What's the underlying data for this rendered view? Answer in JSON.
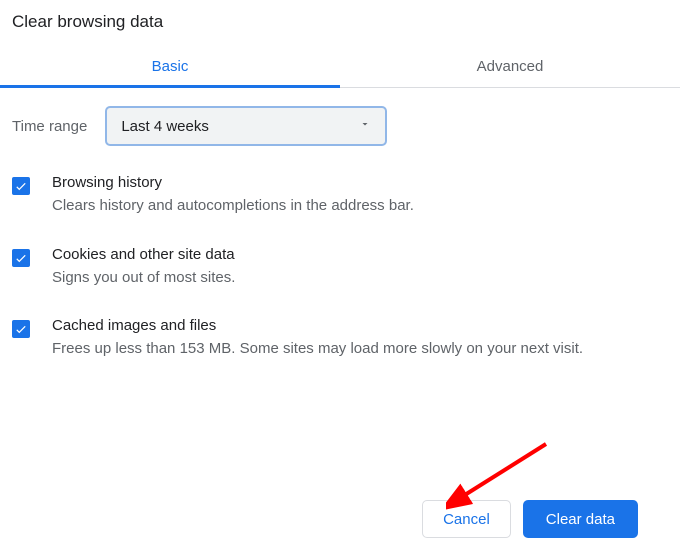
{
  "dialog": {
    "title": "Clear browsing data"
  },
  "tabs": {
    "basic": "Basic",
    "advanced": "Advanced"
  },
  "time": {
    "label": "Time range",
    "selected": "Last 4 weeks"
  },
  "options": [
    {
      "title": "Browsing history",
      "desc": "Clears history and autocompletions in the address bar."
    },
    {
      "title": "Cookies and other site data",
      "desc": "Signs you out of most sites."
    },
    {
      "title": "Cached images and files",
      "desc": "Frees up less than 153 MB. Some sites may load more slowly on your next visit."
    }
  ],
  "buttons": {
    "cancel": "Cancel",
    "clear": "Clear data"
  }
}
